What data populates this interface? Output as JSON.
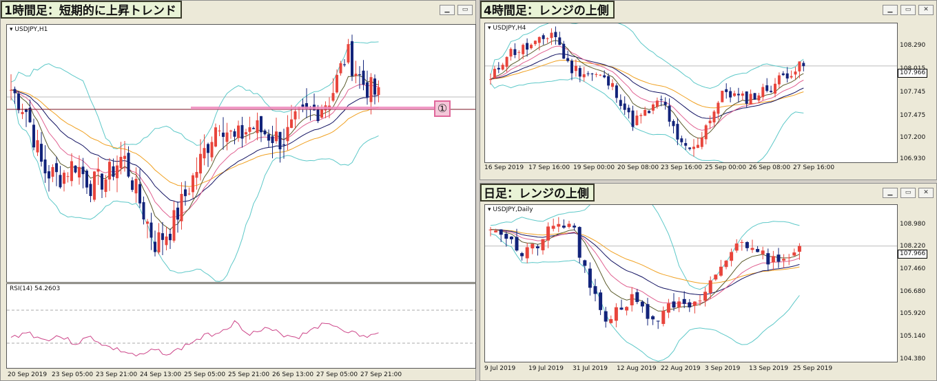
{
  "windows": {
    "h1": {
      "caption": "1時間足：短期的に上昇トレンド",
      "symbol": "USDJPY,H1",
      "rsi_label": "RSI(14) 54.2603",
      "marker": "①",
      "x_labels": [
        "20 Sep 2019",
        "23 Sep 05:00",
        "23 Sep 21:00",
        "24 Sep 13:00",
        "25 Sep 05:00",
        "25 Sep 21:00",
        "26 Sep 13:00",
        "27 Sep 05:00",
        "27 Sep 21:00"
      ]
    },
    "h4": {
      "caption": "4時間足：レンジの上側",
      "symbol": "USDJPY,H4",
      "current_price": "107.966",
      "y_labels": [
        "108.290",
        "108.015",
        "107.745",
        "107.475",
        "107.200",
        "106.930"
      ],
      "x_labels": [
        "16 Sep 2019",
        "17 Sep 16:00",
        "19 Sep 00:00",
        "20 Sep 08:00",
        "23 Sep 16:00",
        "25 Sep 00:00",
        "26 Sep 08:00",
        "27 Sep 16:00"
      ]
    },
    "daily": {
      "caption": "日足：レンジの上側",
      "symbol": "USDJPY,Daily",
      "current_price": "107.966",
      "y_labels": [
        "108.980",
        "108.220",
        "107.460",
        "106.680",
        "105.920",
        "105.140",
        "104.380"
      ],
      "x_labels": [
        "9 Jul 2019",
        "19 Jul 2019",
        "31 Jul 2019",
        "12 Aug 2019",
        "22 Aug 2019",
        "3 Sep 2019",
        "13 Sep 2019",
        "25 Sep 2019"
      ]
    }
  },
  "window_buttons": {
    "minimize": "▁",
    "restore": "▭",
    "close": "✕"
  },
  "colors": {
    "bull": "#e8453c",
    "bear": "#12237a",
    "bands": "#5cc8c8",
    "ma_orange": "#f0a020",
    "ma_pink": "#e06090",
    "ma_olive": "#5a5a2a",
    "ma_navy": "#101060",
    "rsi": "#cc4488"
  },
  "chart_data": [
    {
      "type": "candlestick",
      "title": "USDJPY,H1",
      "x": [
        "20 Sep 2019",
        "23 Sep 05:00",
        "23 Sep 21:00",
        "24 Sep 13:00",
        "25 Sep 05:00",
        "25 Sep 21:00",
        "26 Sep 13:00",
        "27 Sep 05:00",
        "27 Sep 21:00"
      ],
      "close_trend": [
        108.05,
        107.55,
        107.4,
        107.0,
        107.55,
        107.85,
        107.8,
        108.1,
        108.0
      ],
      "indicators": [
        "Bollinger Bands",
        "Moving Averages",
        "RSI(14) 54.2603"
      ]
    },
    {
      "type": "candlestick",
      "title": "USDJPY,H4",
      "x": [
        "16 Sep 2019",
        "17 Sep 16:00",
        "19 Sep 00:00",
        "20 Sep 08:00",
        "23 Sep 16:00",
        "25 Sep 00:00",
        "26 Sep 08:00",
        "27 Sep 16:00"
      ],
      "close_trend": [
        107.85,
        108.15,
        108.2,
        107.9,
        107.4,
        107.05,
        107.7,
        107.966
      ],
      "ylim": [
        106.93,
        108.29
      ],
      "last": 107.966
    },
    {
      "type": "candlestick",
      "title": "USDJPY,Daily",
      "x": [
        "9 Jul 2019",
        "19 Jul 2019",
        "31 Jul 2019",
        "12 Aug 2019",
        "22 Aug 2019",
        "3 Sep 2019",
        "13 Sep 2019",
        "25 Sep 2019"
      ],
      "close_trend": [
        108.7,
        107.7,
        108.6,
        105.6,
        106.3,
        106.0,
        108.1,
        107.966
      ],
      "ylim": [
        104.38,
        108.98
      ],
      "last": 107.966
    }
  ]
}
